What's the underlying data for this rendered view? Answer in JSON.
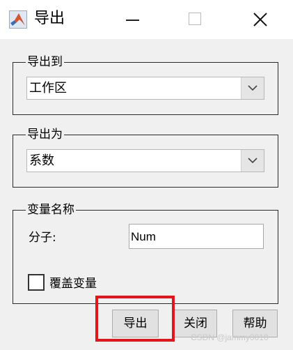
{
  "window": {
    "title": "导出",
    "icon": "matlab-icon",
    "controls": {
      "minimize": "minimize-icon",
      "maximize": "maximize-icon",
      "close": "close-icon"
    }
  },
  "export_to": {
    "group_label": "导出到",
    "selected": "工作区"
  },
  "export_as": {
    "group_label": "导出为",
    "selected": "系数"
  },
  "variable_names": {
    "group_label": "变量名称",
    "numerator_label": "分子:",
    "numerator_value": "Num",
    "overwrite_label": "覆盖变量",
    "overwrite_checked": false
  },
  "buttons": {
    "export": "导出",
    "close": "关闭",
    "help": "帮助"
  },
  "watermark": "CSDN @jammy0010",
  "colors": {
    "highlight": "#e3151b",
    "background": "#f0f0f0",
    "button": "#e1e1e1"
  }
}
